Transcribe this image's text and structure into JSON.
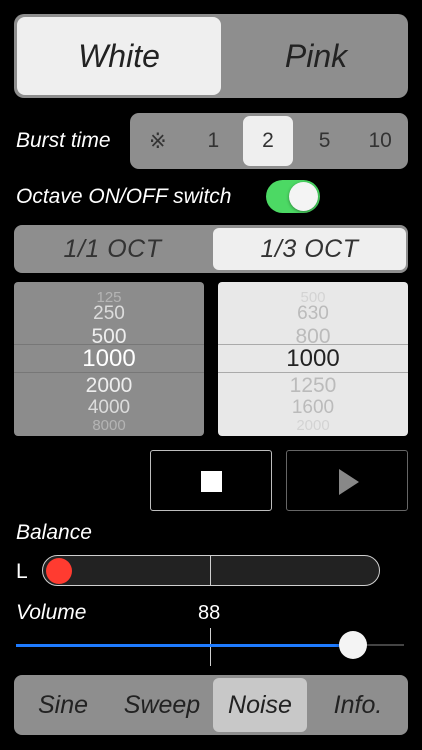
{
  "noise_type": {
    "options": [
      "White",
      "Pink"
    ],
    "selected": "White"
  },
  "burst": {
    "label": "Burst time",
    "options": [
      "※",
      "1",
      "2",
      "5",
      "10"
    ],
    "selected": "2"
  },
  "octave_switch": {
    "label": "Octave ON/OFF switch",
    "on": true
  },
  "octave_mode": {
    "options": [
      "1/1 OCT",
      "1/3 OCT"
    ],
    "selected": "1/3 OCT"
  },
  "picker_1_1": {
    "values": [
      "125",
      "250",
      "500",
      "1000",
      "2000",
      "4000",
      "8000"
    ],
    "selected": "1000"
  },
  "picker_1_3": {
    "values": [
      "500",
      "630",
      "800",
      "1000",
      "1250",
      "1600",
      "2000"
    ],
    "selected": "1000"
  },
  "transport": {
    "stop_icon": "stop-icon",
    "play_icon": "play-icon"
  },
  "balance": {
    "label": "Balance",
    "side_label": "L",
    "value": -1.0
  },
  "volume": {
    "label": "Volume",
    "value_text": "88",
    "value": 0.88
  },
  "tabs": {
    "items": [
      "Sine",
      "Sweep",
      "Noise",
      "Info."
    ],
    "selected": "Noise"
  },
  "colors": {
    "accent_blue": "#1e7bff",
    "toggle_green": "#4cd964",
    "balance_knob_red": "#ff3b30"
  }
}
